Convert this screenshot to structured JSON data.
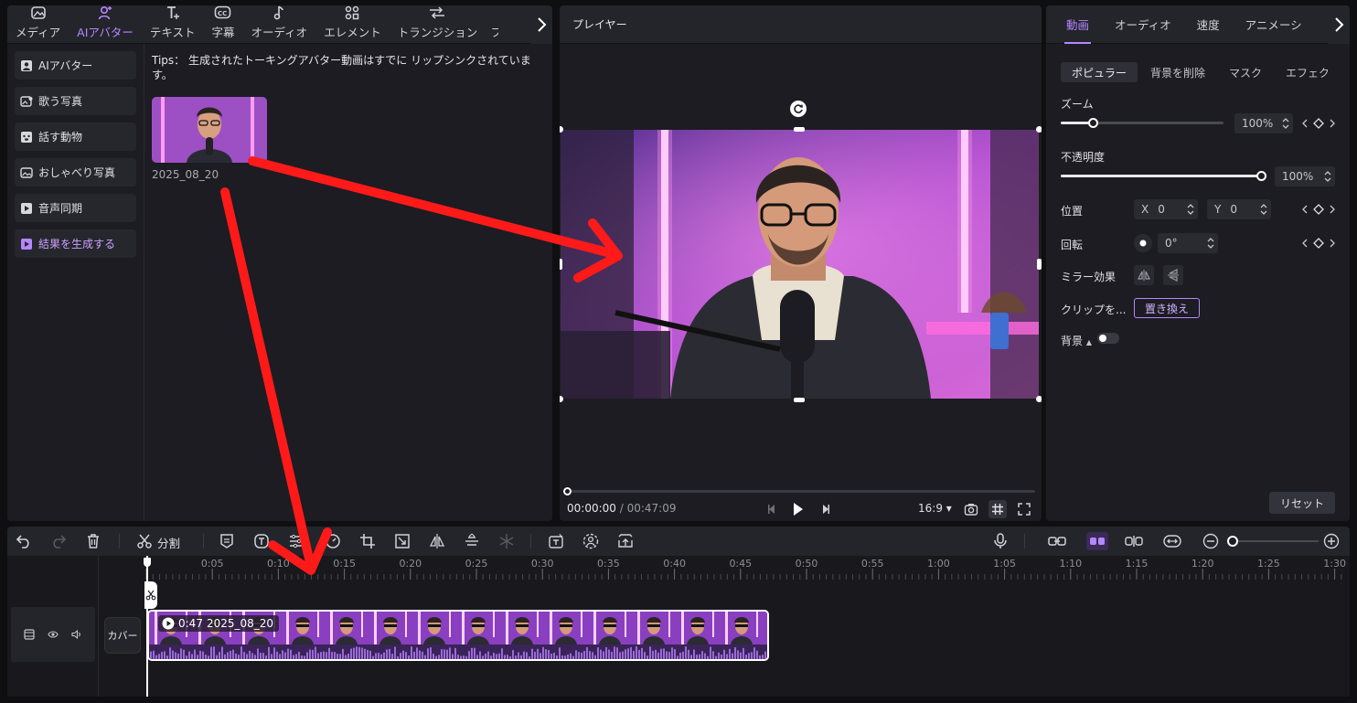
{
  "top_tabs": [
    {
      "label": "メディア",
      "icon": "media-icon"
    },
    {
      "label": "AIアバター",
      "icon": "avatar-icon"
    },
    {
      "label": "テキスト",
      "icon": "text-icon"
    },
    {
      "label": "字幕",
      "icon": "captions-icon"
    },
    {
      "label": "オーディオ",
      "icon": "audio-icon"
    },
    {
      "label": "エレメント",
      "icon": "elements-icon"
    },
    {
      "label": "トランジション",
      "icon": "transition-icon"
    },
    {
      "label": "フ",
      "icon": ""
    }
  ],
  "sub_nav": [
    {
      "label": "AIアバター"
    },
    {
      "label": "歌う写真"
    },
    {
      "label": "話す動物"
    },
    {
      "label": "おしゃべり写真"
    },
    {
      "label": "音声同期"
    },
    {
      "label": "結果を生成する"
    }
  ],
  "media": {
    "tips": "Tips：  生成されたトーキングアバター動画はすでに リップシンクされています。",
    "item_name": "2025_08_20"
  },
  "player": {
    "title": "プレイヤー",
    "current_time": "00:00:00",
    "separator": " / ",
    "total_time": "00:47:09",
    "aspect": "16:9",
    "progress": 0
  },
  "props": {
    "tabs": [
      "動画",
      "オーディオ",
      "速度",
      "アニメーション"
    ],
    "subtabs": [
      "ポピュラー",
      "背景を削除",
      "マスク",
      "エフェクト"
    ],
    "zoom_label": "ズーム",
    "zoom_value": "100%",
    "zoom_level": 0.2,
    "opacity_label": "不透明度",
    "opacity_value": "100%",
    "opacity_level": 1.0,
    "position_label": "位置",
    "pos_x_label": "X",
    "pos_x": "0",
    "pos_y_label": "Y",
    "pos_y": "0",
    "rotation_label": "回転",
    "rotation_value": "0°",
    "mirror_label": "ミラー効果",
    "clip_label": "クリップを...",
    "replace_label": "置き換え",
    "background_label": "背景",
    "reset_label": "リセット"
  },
  "timeline": {
    "split_label": "分割",
    "cover_label": "カバー",
    "clip_duration": "0:47",
    "clip_name": "2025_08_20",
    "ticks": [
      "0:05",
      "0:10",
      "0:15",
      "0:20",
      "0:25",
      "0:30",
      "0:35",
      "0:40",
      "0:45",
      "0:50",
      "0:55",
      "1:00",
      "1:05",
      "1:10",
      "1:15",
      "1:20",
      "1:25",
      "1:30"
    ]
  },
  "colors": {
    "accent": "#b487ff",
    "annotation": "#ff1a1a",
    "clip": "#6b3aa8"
  }
}
